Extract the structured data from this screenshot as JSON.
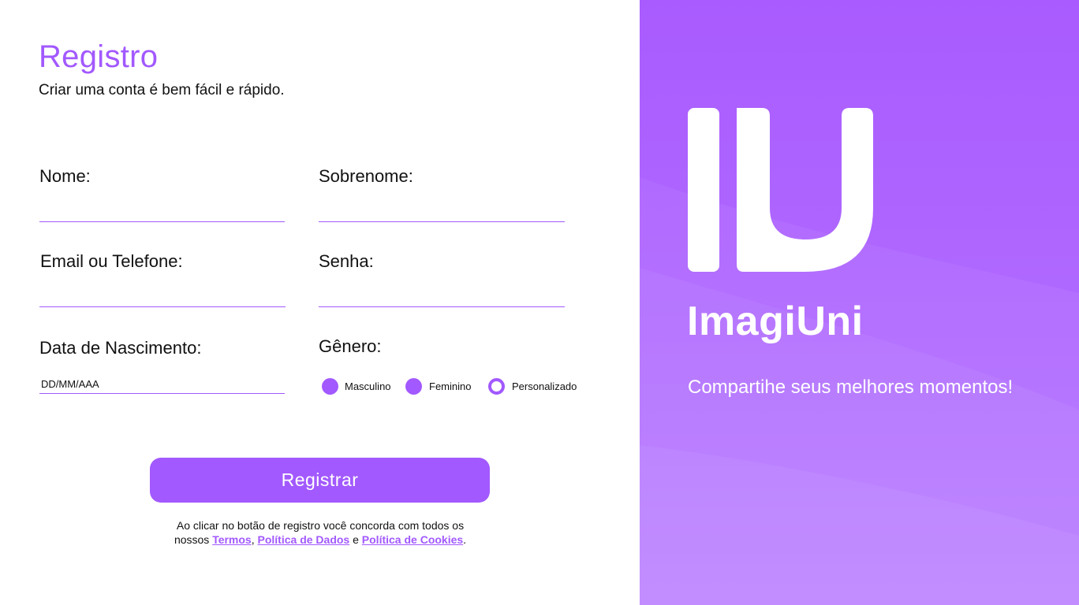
{
  "form": {
    "title": "Registro",
    "subtitle": "Criar uma conta é bem fácil e rápido.",
    "fields": {
      "nome": "Nome:",
      "sobrenome": "Sobrenome:",
      "email": "Email ou Telefone:",
      "senha": "Senha:",
      "nascimento": "Data de Nascimento:",
      "nascimento_value": "DD/MM/AAA",
      "genero": "Gênero:"
    },
    "gender_options": [
      "Masculino",
      "Feminino",
      "Personalizado"
    ],
    "submit_label": "Registrar",
    "terms": {
      "line1": "Ao clicar no botão de registro você concorda com todos os",
      "prefix": "nossos",
      "link_terms": "Termos",
      "comma": ",",
      "link_data": "Política de Dados",
      "and": "e",
      "link_cookies": "Política de Cookies",
      "period": "."
    }
  },
  "brand": {
    "name": "ImagiUni",
    "tagline": "Compartihe seus melhores momentos!",
    "logo_icon": "iu-logo-icon"
  },
  "colors": {
    "accent": "#a259ff",
    "panel": "#aa5cff",
    "text": "#111111",
    "white": "#ffffff"
  }
}
